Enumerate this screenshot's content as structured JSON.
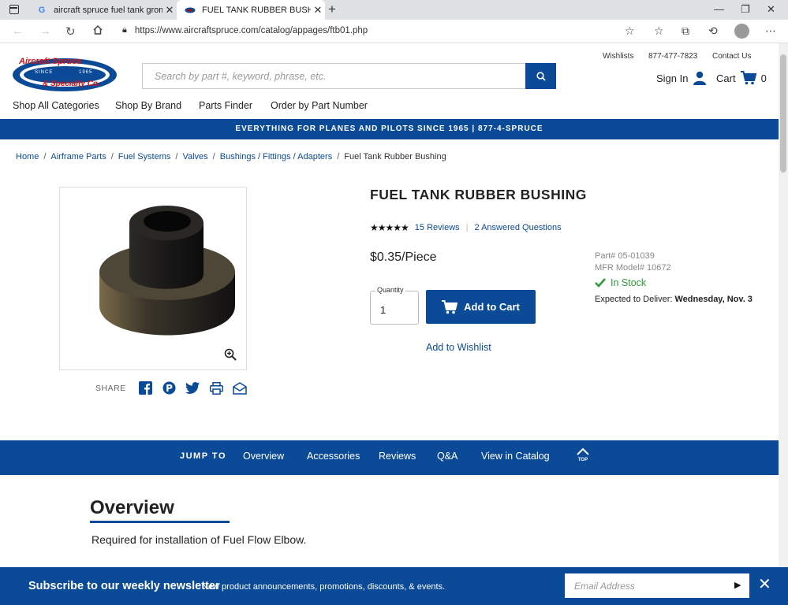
{
  "browser": {
    "tabs": [
      {
        "title": "aircraft spruce fuel tank gromme",
        "favicon": "G"
      },
      {
        "title": "FUEL TANK RUBBER BUSHING | A"
      }
    ],
    "url": "https://www.aircraftspruce.com/catalog/appages/ftb01.php"
  },
  "header": {
    "logo_text_top": "Aircraft Spruce",
    "logo_text_bottom": "& Specialty Co.",
    "logo_since": "SINCE",
    "logo_year": "1965",
    "util_links": [
      "Wishlists",
      "877-477-7823",
      "Contact Us"
    ],
    "search_placeholder": "Search by part #, keyword, phrase, etc.",
    "sign_in": "Sign In",
    "cart_label": "Cart",
    "cart_count": "0",
    "nav": [
      "Shop All Categories",
      "Shop By Brand",
      "Parts Finder",
      "Order by Part Number"
    ]
  },
  "banner": "EVERYTHING FOR PLANES AND PILOTS SINCE 1965 | 877-4-SPRUCE",
  "breadcrumb": [
    "Home",
    "Airframe Parts",
    "Fuel Systems",
    "Valves",
    "Bushings / Fittings / Adapters",
    "Fuel Tank Rubber Bushing"
  ],
  "product": {
    "title": "FUEL TANK RUBBER BUSHING",
    "stars": "★★★★★",
    "reviews": "15 Reviews",
    "questions": "2 Answered Questions",
    "price": "$0.35/Piece",
    "quantity_label": "Quantity",
    "quantity": "1",
    "add_to_cart": "Add to Cart",
    "add_to_wishlist": "Add to Wishlist",
    "part_number": "Part# 05-01039",
    "mfr_model": "MFR Model# 10672",
    "stock": "In Stock",
    "deliver_label": "Expected to Deliver:",
    "deliver_date": "Wednesday, Nov. 3",
    "share_label": "SHARE"
  },
  "jump": {
    "label": "JUMP TO",
    "items": [
      "Overview",
      "Accessories",
      "Reviews",
      "Q&A",
      "View in Catalog"
    ],
    "top": "TOP"
  },
  "overview": {
    "title": "Overview",
    "text": "Required for installation of Fuel Flow Elbow."
  },
  "newsletter": {
    "title": "Subscribe to our weekly newsletter",
    "subtitle": "New product announcements, promotions, discounts, & events.",
    "placeholder": "Email Address"
  },
  "colors": {
    "brand_blue": "#0a4a96",
    "stock_green": "#2a9d3a"
  }
}
